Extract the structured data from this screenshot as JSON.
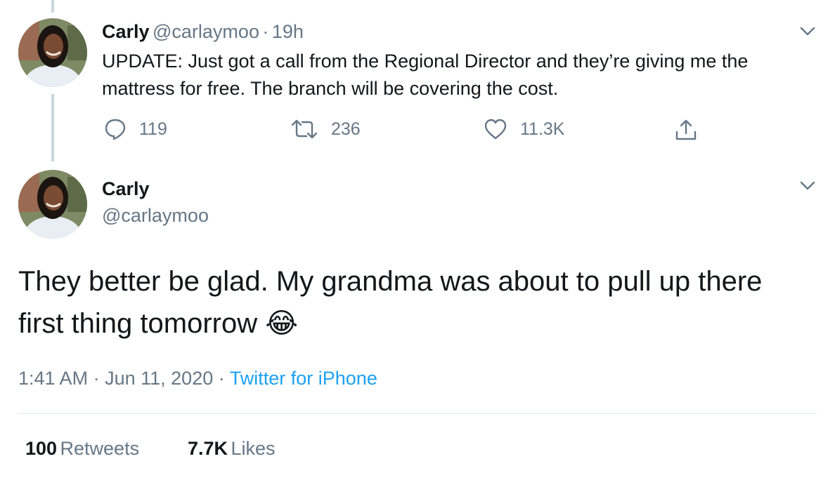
{
  "tweet1": {
    "name": "Carly",
    "handle": "@carlaymoo",
    "separator": "·",
    "time": "19h",
    "text": "UPDATE: Just got a call from the Regional Director and they’re giving me the mattress for free. The branch will be covering the cost.",
    "actions": {
      "replies": "119",
      "retweets": "236",
      "likes": "11.3K"
    }
  },
  "tweet2": {
    "name": "Carly",
    "handle": "@carlaymoo",
    "text": "They better be glad. My grandma was about to pull up there first thing tomorrow",
    "emoji": "😂",
    "time": "1:41 AM",
    "separator1": "·",
    "date": "Jun 11, 2020",
    "separator2": "·",
    "source": "Twitter for iPhone",
    "stats": {
      "retweets_count": "100",
      "retweets_label": "Retweets",
      "likes_count": "7.7K",
      "likes_label": "Likes"
    }
  },
  "colors": {
    "text": "#14171a",
    "secondary": "#657786",
    "link": "#1da1f2",
    "divider": "#e1e8ed",
    "thread_line": "#ccd6dd"
  },
  "icons": {
    "reply": "reply-icon",
    "retweet": "retweet-icon",
    "like": "heart-icon",
    "share": "share-icon",
    "more": "chevron-down-icon"
  }
}
